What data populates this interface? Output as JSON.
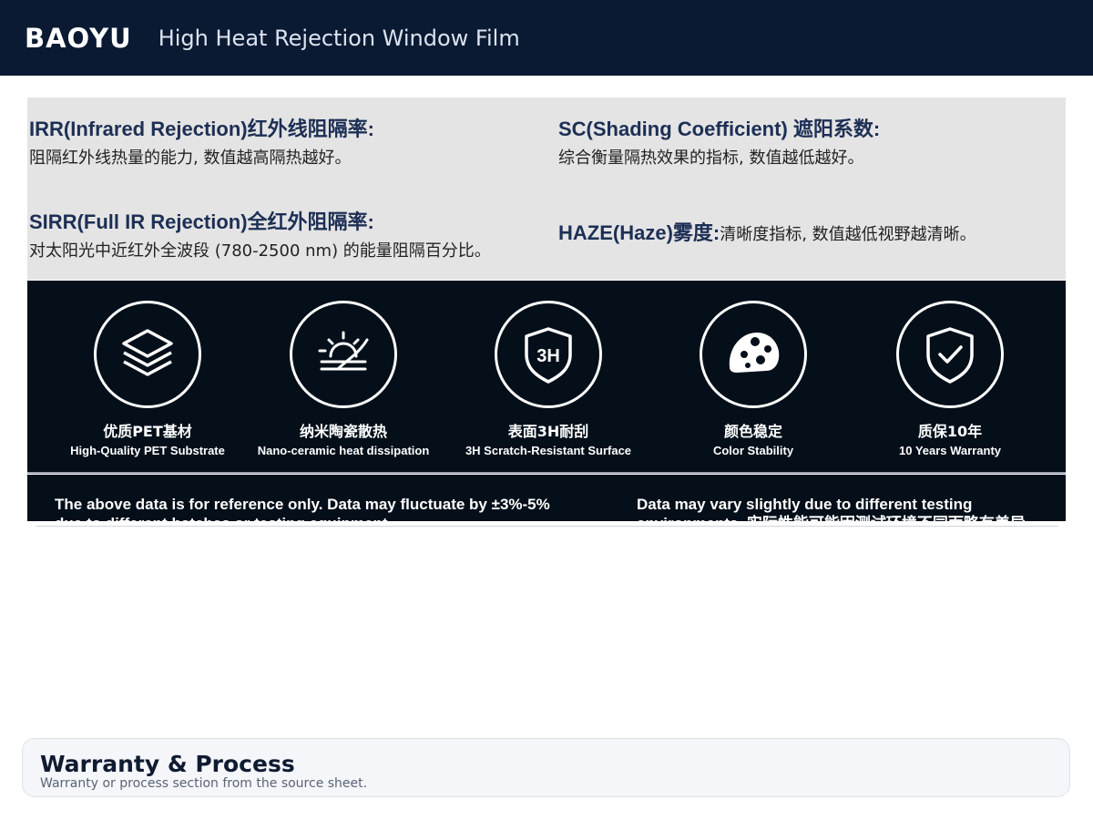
{
  "header": {
    "brand": "BAOYU",
    "title": "High Heat Rejection Window Film"
  },
  "definitions": [
    {
      "title": "IRR(Infrared Rejection)红外线阻隔率:",
      "body": "阻隔红外线热量的能力, 数值越高隔热越好。"
    },
    {
      "title": "SC(Shading Coefficient) 遮阳系数:",
      "body": "综合衡量隔热效果的指标, 数值越低越好。"
    },
    {
      "title": "SIRR(Full IR Rejection)全红外阻隔率:",
      "body": "对太阳光中近红外全波段 (780-2500 nm) 的能量阻隔百分比。"
    },
    {
      "title": "HAZE(Haze)雾度:",
      "body": "清晰度指标, 数值越低视野越清晰。"
    }
  ],
  "features": [
    {
      "icon": "layers-icon",
      "cn": "优质PET基材",
      "en": "High-Quality PET Substrate"
    },
    {
      "icon": "sun-heat-icon",
      "cn": "纳米陶瓷散热",
      "en": "Nano-ceramic heat dissipation"
    },
    {
      "icon": "shield-3h-icon",
      "cn": "表面3H耐刮",
      "en": "3H Scratch-Resistant Surface"
    },
    {
      "icon": "palette-icon",
      "cn": "颜色稳定",
      "en": "Color Stability"
    },
    {
      "icon": "shield-check-icon",
      "cn": "质保10年",
      "en": "10 Years Warranty"
    }
  ],
  "notes": {
    "left": "The above data is for reference only. Data may fluctuate by ±3%-5% due to different batches or testing equipment.",
    "right": "Data may vary slightly due to different testing environments. 实际性能可能因测试环境不同而略有差异。"
  },
  "warranty": {
    "title": "Warranty & Process",
    "subtitle": "Warranty or process section from the source sheet."
  }
}
